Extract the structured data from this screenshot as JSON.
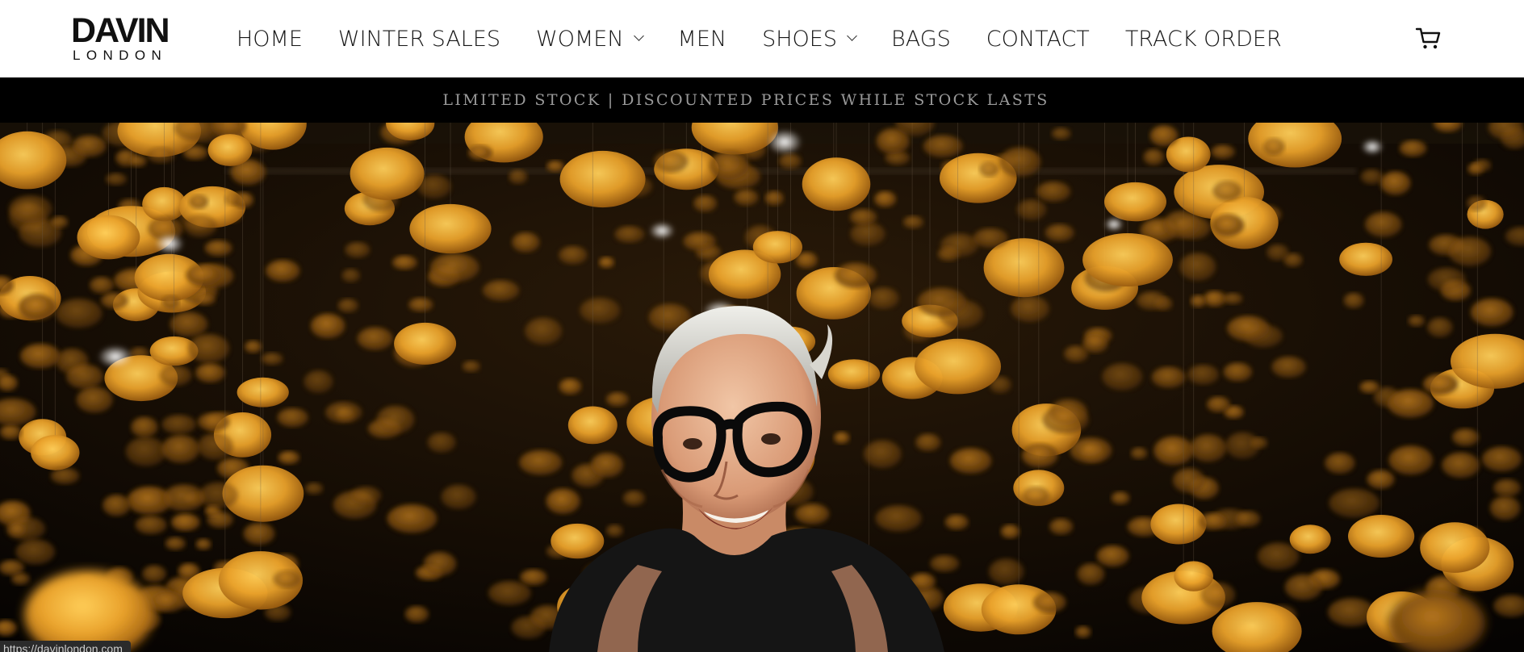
{
  "brand": {
    "name_top": "DAVIN",
    "name_bottom": "LONDON"
  },
  "nav": {
    "items": [
      {
        "label": "HOME",
        "has_dropdown": false
      },
      {
        "label": "WINTER SALES",
        "has_dropdown": false
      },
      {
        "label": "WOMEN",
        "has_dropdown": true
      },
      {
        "label": "MEN",
        "has_dropdown": false
      },
      {
        "label": "SHOES",
        "has_dropdown": true
      },
      {
        "label": "BAGS",
        "has_dropdown": false
      },
      {
        "label": "CONTACT",
        "has_dropdown": false
      },
      {
        "label": "TRACK ORDER",
        "has_dropdown": false
      }
    ],
    "cart_icon": "cart-icon"
  },
  "announcement": {
    "text": "LIMITED STOCK | DISCOUNTED PRICES WHILE STOCK LASTS"
  },
  "hero": {
    "image_subject": "smiling woman with glasses under hanging marigolds"
  },
  "status_bar": {
    "url": "https://davinlondon.com"
  },
  "colors": {
    "header_bg": "#ffffff",
    "announcement_bg": "#000000",
    "announcement_text": "#9a9a9a",
    "marigold": "#e9a12a"
  }
}
